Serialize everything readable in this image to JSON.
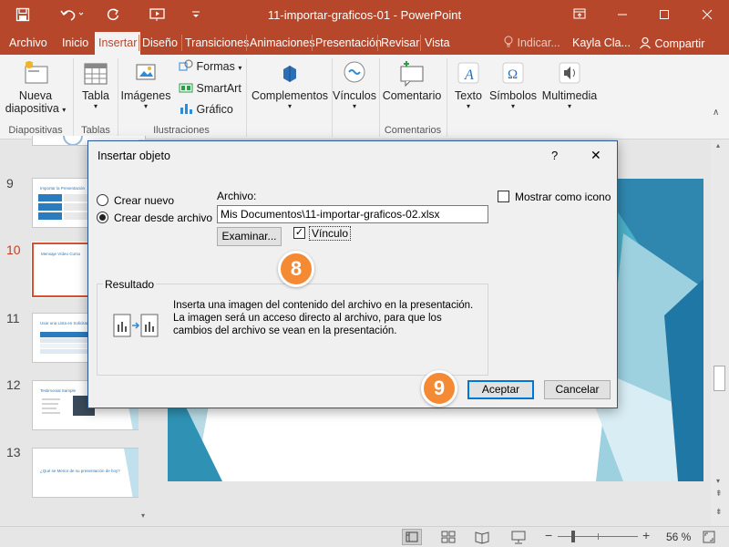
{
  "window": {
    "title": "11-importar-graficos-01  -  PowerPoint"
  },
  "quick_access": {
    "save_icon": "save-icon",
    "undo_icon": "undo-icon",
    "redo_icon": "repeat-icon",
    "present_icon": "start-from-beginning-icon",
    "customize_icon": "customize-qat-icon"
  },
  "tabs": [
    "Archivo",
    "Inicio",
    "Insertar",
    "Diseño",
    "Transiciones",
    "Animaciones",
    "Presentación",
    "Revisar",
    "Vista"
  ],
  "active_tab": "Insertar",
  "tell_me": "Indicar...",
  "user": "Kayla Cla...",
  "share": "Compartir",
  "ribbon": {
    "new_slide": {
      "line1": "Nueva",
      "line2": "diapositiva"
    },
    "table": "Tabla",
    "images": "Imágenes",
    "shapes": "Formas",
    "smartart": "SmartArt",
    "chart": "Gráfico",
    "addins": "Complementos",
    "links": "Vínculos",
    "comment": "Comentario",
    "text": "Texto",
    "symbols": "Símbolos",
    "media": "Multimedia",
    "groups": {
      "slides": "Diapositivas",
      "tables": "Tablas",
      "illustrations": "Ilustraciones",
      "comments": "Comentarios"
    }
  },
  "slides": [
    {
      "num": "9",
      "title": "Importar la Presentación"
    },
    {
      "num": "10",
      "title": "Mensaje Vídeo Curso",
      "selected": true
    },
    {
      "num": "11",
      "title": "Usar una Lista en Solicitamiento"
    },
    {
      "num": "12",
      "title": "Testimonial Sample"
    },
    {
      "num": "13",
      "title": "¿Qué se Menor de su presentación de hoy?"
    }
  ],
  "dialog": {
    "title": "Insertar objeto",
    "help": "?",
    "close": "✕",
    "create_new": "Crear nuevo",
    "create_from_file": "Crear desde archivo",
    "file_label": "Archivo:",
    "file_value": "Mis Documentos\\11-importar-graficos-02.xlsx",
    "browse": "Examinar...",
    "link": "Vínculo",
    "link_checked": true,
    "display_as_icon": "Mostrar como icono",
    "result_label": "Resultado",
    "result_text": "Inserta una imagen del contenido del archivo en la presentación. La imagen será un acceso directo al archivo, para que los cambios del archivo se vean en la presentación.",
    "ok": "Aceptar",
    "cancel": "Cancelar"
  },
  "callouts": {
    "step_a": "8",
    "step_b": "9"
  },
  "status": {
    "zoom": "56 %"
  },
  "colors": {
    "brand": "#b7472a",
    "badge": "#f58a34",
    "accent": "#0078d7"
  }
}
